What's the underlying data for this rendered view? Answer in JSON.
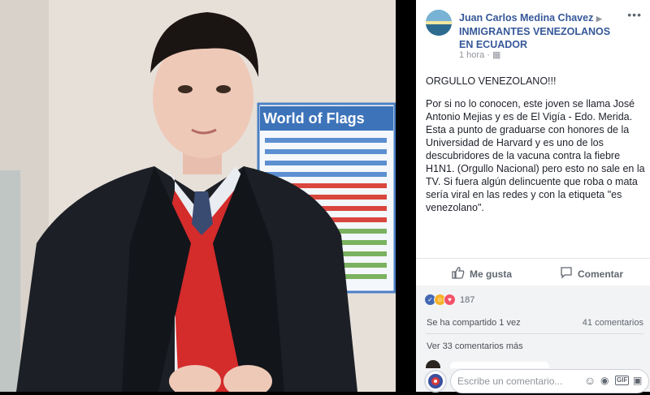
{
  "post": {
    "author": "Juan Carlos Medina Chavez",
    "group": "INMIGRANTES VENEZOLANOS EN ECUADOR",
    "time": "1 hora",
    "title": "ORGULLO VENEZOLANO!!!",
    "text": "Por si no lo conocen, este joven se llama José Antonio Mejias y es de El Vigía - Edo. Merida. Esta a punto de graduarse con honores de la Universidad de Harvard y es uno de los descubridores de la vacuna contra la fiebre H1N1. (Orgullo Nacional) pero esto no sale en la TV. Si fuera algún delincuente que roba o mata sería viral en las redes y con la etiqueta \"es venezolano\"."
  },
  "actions": {
    "like": "Me gusta",
    "comment": "Comentar"
  },
  "stats": {
    "reactions_count": "187",
    "shared": "Se ha compartido 1 vez",
    "comments": "41 comentarios",
    "view_more": "Ver 33 comentarios más"
  },
  "comment_input": {
    "placeholder": "Escribe un comentario..."
  },
  "poster": {
    "title": "World of Flags"
  },
  "colors": {
    "link": "#365899",
    "like_blue": "#4267b2",
    "love_red": "#f25268",
    "haha_yellow": "#f7b125"
  }
}
